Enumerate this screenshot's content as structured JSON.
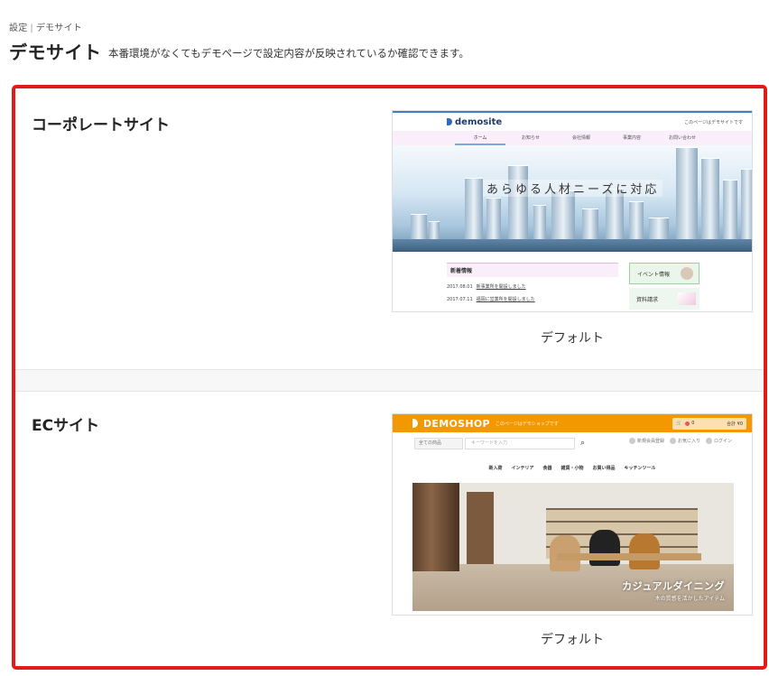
{
  "breadcrumb": {
    "items": [
      "設定",
      "デモサイト"
    ],
    "separator": "|"
  },
  "page": {
    "title": "デモサイト",
    "description": "本番環境がなくてもデモページで設定内容が反映されているか確認できます。"
  },
  "colors": {
    "frame_border": "#e11b1b",
    "corporate_accent": "#3f7fc4",
    "ec_header": "#f39800"
  },
  "sections": [
    {
      "title": "コーポレートサイト",
      "caption": "デフォルト",
      "preview": {
        "logo": "demosite",
        "top_right": "このページはデモサイトです",
        "nav": [
          "ホーム",
          "お知らせ",
          "会社情報",
          "事業内容",
          "お問い合わせ"
        ],
        "hero_text": "あらゆる人材ニーズに対応",
        "news_title": "新着情報",
        "news": [
          {
            "date": "2017.08.01",
            "text": "新事業所を開設しました"
          },
          {
            "date": "2017.07.11",
            "text": "福岡に営業所を開設しました"
          }
        ],
        "banners": [
          "イベント情報",
          "資料請求"
        ]
      }
    },
    {
      "title": "ECサイト",
      "caption": "デフォルト",
      "preview": {
        "logo": "DEMOSHOP",
        "tagline": "このページはデモショップです",
        "cart_amount": "0",
        "cart_total": "合計 ¥0",
        "search_select": "全ての商品",
        "search_placeholder": "キーワードを入力",
        "user_links": [
          "新規会員登録",
          "お気に入り",
          "ログイン"
        ],
        "categories": [
          "新入荷",
          "インテリア",
          "食器",
          "雑貨・小物",
          "お買い得品",
          "キッチンツール"
        ],
        "hero_copy": "カジュアルダイニング",
        "hero_sub": "木の質感を活かしたアイテム"
      }
    }
  ]
}
